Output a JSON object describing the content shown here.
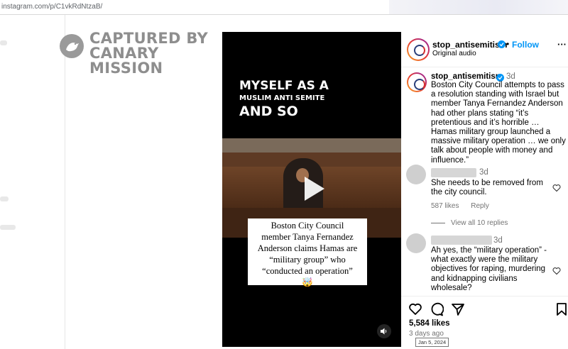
{
  "browser": {
    "url": "instagram.com/p/C1vkRdNtzaB/"
  },
  "watermark": {
    "line1": "CAPTURED BY",
    "line2": "CANARY MISSION"
  },
  "video": {
    "overlay_line1": "MYSELF AS A",
    "overlay_line2": "MUSLIM ANTI SEMITE",
    "overlay_line3": "AND SO",
    "card_lines": [
      "Boston City Council",
      "member Tanya Fernandez",
      "Anderson claims Hamas are",
      "“military group” who",
      "“conducted an operation”",
      "🤯"
    ],
    "play_icon": "play-icon",
    "mute_icon": "speaker-icon"
  },
  "header": {
    "username": "stop_antisemitism",
    "separator": "•",
    "follow_label": "Follow",
    "audio_label": "Original audio",
    "more_label": "···"
  },
  "post": {
    "username": "stop_antisemitism",
    "time": "3d",
    "caption": "Boston City Council attempts to pass a resolution standing with Israel but member Tanya Fernandez Anderson had other plans stating “it’s pretentious and it’s horrible … Hamas military group launched a massive military operation … we only talk about people with money and influence.”"
  },
  "comments": [
    {
      "time": "3d",
      "text": "She needs to be removed from the city council.",
      "likes": "587 likes",
      "reply": "Reply"
    },
    {
      "time": "3d",
      "text": "Ah yes, the “military operation” - what exactly were the military objectives for raping, murdering and kidnapping civilians wholesale?"
    }
  ],
  "view_all": "View all 10 replies",
  "footer": {
    "likes": "5,584 likes",
    "ago": "3 days ago",
    "tooltip": "Jan 5, 2024"
  },
  "colors": {
    "accent": "#0095f6",
    "muted": "#737373",
    "watermark": "#8e8e8e"
  }
}
